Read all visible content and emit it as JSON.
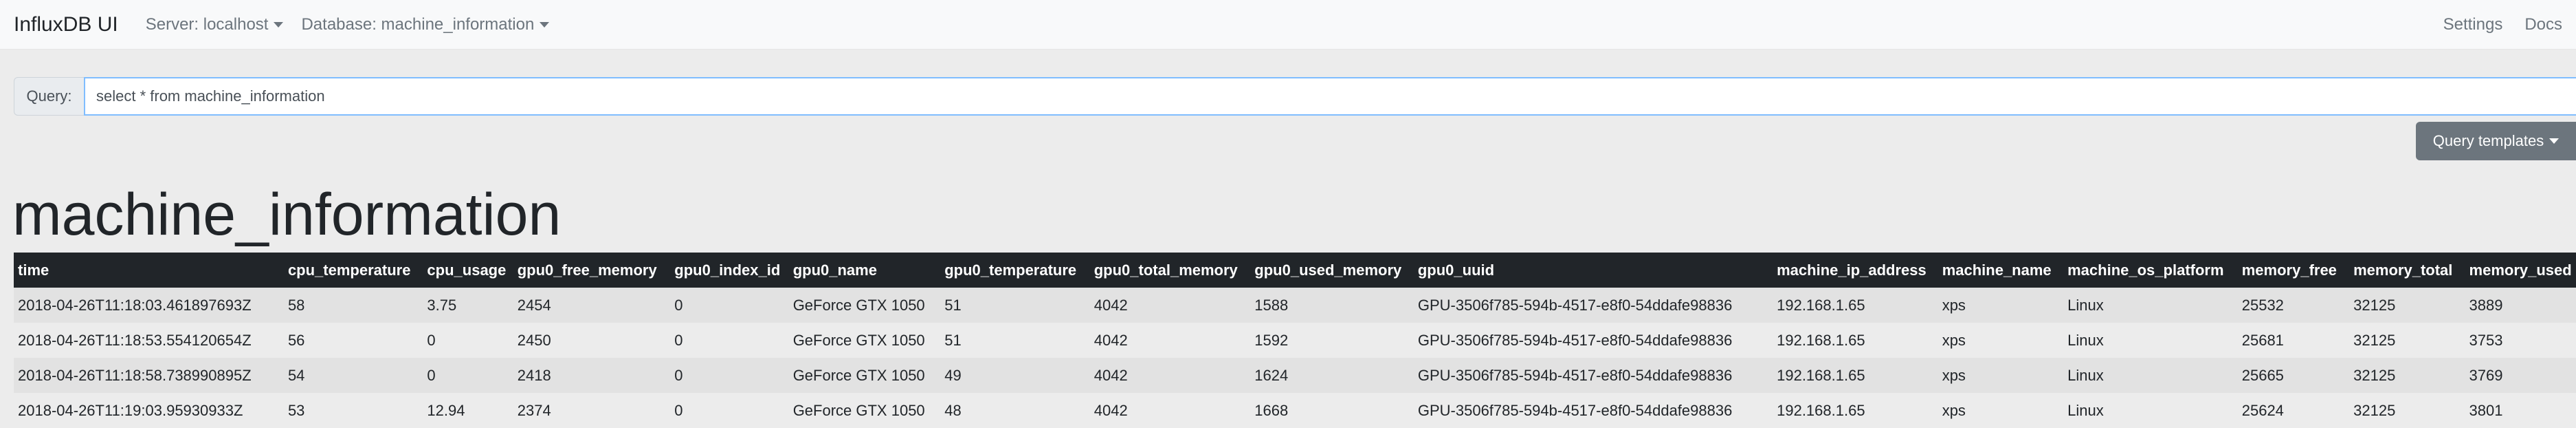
{
  "navbar": {
    "brand": "InfluxDB UI",
    "server_label": "Server: localhost",
    "database_label": "Database: machine_information",
    "settings": "Settings",
    "docs": "Docs"
  },
  "query": {
    "label": "Query:",
    "value": "select * from machine_information"
  },
  "templates_button": "Query templates",
  "measurement_title": "machine_information",
  "table": {
    "columns": [
      "time",
      "cpu_temperature",
      "cpu_usage",
      "gpu0_free_memory",
      "gpu0_index_id",
      "gpu0_name",
      "gpu0_temperature",
      "gpu0_total_memory",
      "gpu0_used_memory",
      "gpu0_uuid",
      "machine_ip_address",
      "machine_name",
      "machine_os_platform",
      "memory_free",
      "memory_total",
      "memory_used"
    ],
    "rows": [
      [
        "2018-04-26T11:18:03.461897693Z",
        "58",
        "3.75",
        "2454",
        "0",
        "GeForce GTX 1050",
        "51",
        "4042",
        "1588",
        "GPU-3506f785-594b-4517-e8f0-54ddafe98836",
        "192.168.1.65",
        "xps",
        "Linux",
        "25532",
        "32125",
        "3889"
      ],
      [
        "2018-04-26T11:18:53.554120654Z",
        "56",
        "0",
        "2450",
        "0",
        "GeForce GTX 1050",
        "51",
        "4042",
        "1592",
        "GPU-3506f785-594b-4517-e8f0-54ddafe98836",
        "192.168.1.65",
        "xps",
        "Linux",
        "25681",
        "32125",
        "3753"
      ],
      [
        "2018-04-26T11:18:58.738990895Z",
        "54",
        "0",
        "2418",
        "0",
        "GeForce GTX 1050",
        "49",
        "4042",
        "1624",
        "GPU-3506f785-594b-4517-e8f0-54ddafe98836",
        "192.168.1.65",
        "xps",
        "Linux",
        "25665",
        "32125",
        "3769"
      ],
      [
        "2018-04-26T11:19:03.95930933Z",
        "53",
        "12.94",
        "2374",
        "0",
        "GeForce GTX 1050",
        "48",
        "4042",
        "1668",
        "GPU-3506f785-594b-4517-e8f0-54ddafe98836",
        "192.168.1.65",
        "xps",
        "Linux",
        "25624",
        "32125",
        "3801"
      ]
    ]
  }
}
